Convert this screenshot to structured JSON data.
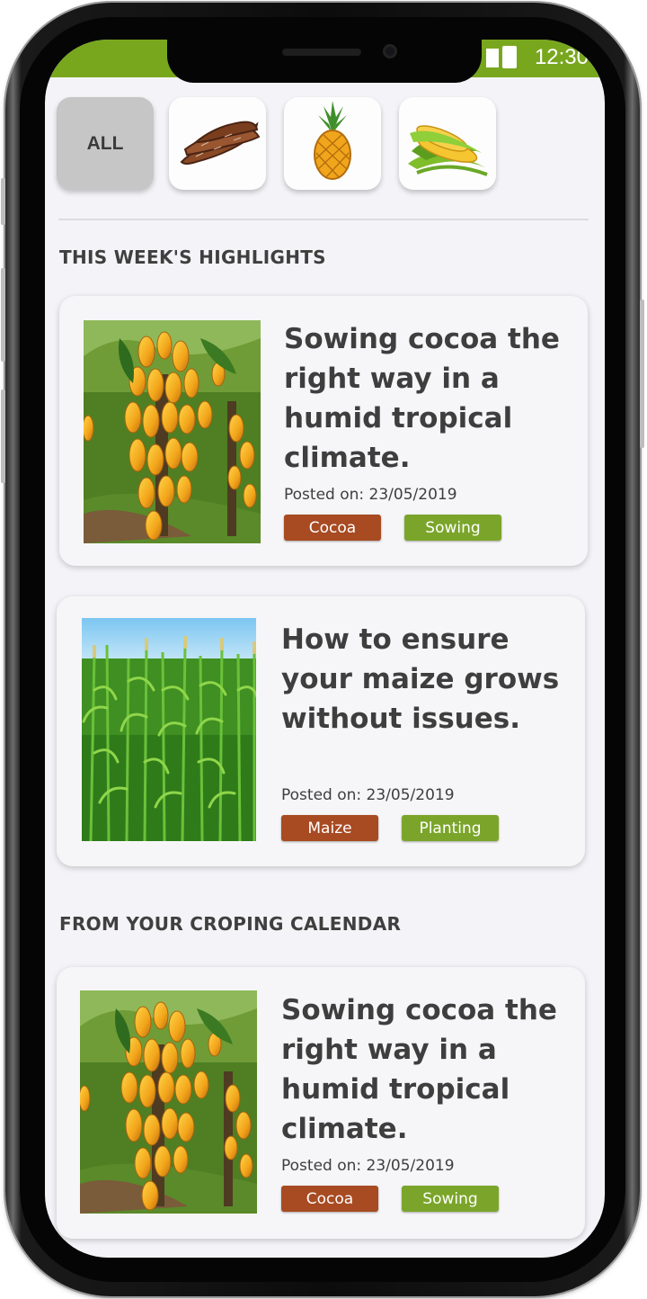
{
  "status_bar": {
    "time": "12:30"
  },
  "categories": [
    {
      "label": "ALL",
      "active": true
    },
    {
      "icon": "cassava-icon",
      "active": false
    },
    {
      "icon": "pineapple-icon",
      "active": false
    },
    {
      "icon": "maize-icon",
      "active": false
    }
  ],
  "sections": {
    "highlights_title": "THIS WEEK'S HIGHLIGHTS",
    "calendar_title": "FROM YOUR CROPING CALENDAR"
  },
  "highlights": [
    {
      "title": "Sowing cocoa the right way in a humid tropical climate.",
      "posted": "Posted on: 23/05/2019",
      "tags": [
        "Cocoa",
        "Sowing"
      ],
      "image": "cocoa-tree-photo"
    },
    {
      "title": "How to ensure your maize grows without issues.",
      "posted": "Posted on: 23/05/2019",
      "tags": [
        "Maize",
        "Planting"
      ],
      "image": "maize-field-photo"
    }
  ],
  "calendar": [
    {
      "title": "Sowing cocoa the right way in a humid tropical climate.",
      "posted": "Posted on: 23/05/2019",
      "tags": [
        "Cocoa",
        "Sowing"
      ],
      "image": "cocoa-tree-photo"
    }
  ],
  "colors": {
    "brand_green": "#78a71e",
    "tag_crop": "#a84a22",
    "tag_stage": "#7ba52a"
  }
}
